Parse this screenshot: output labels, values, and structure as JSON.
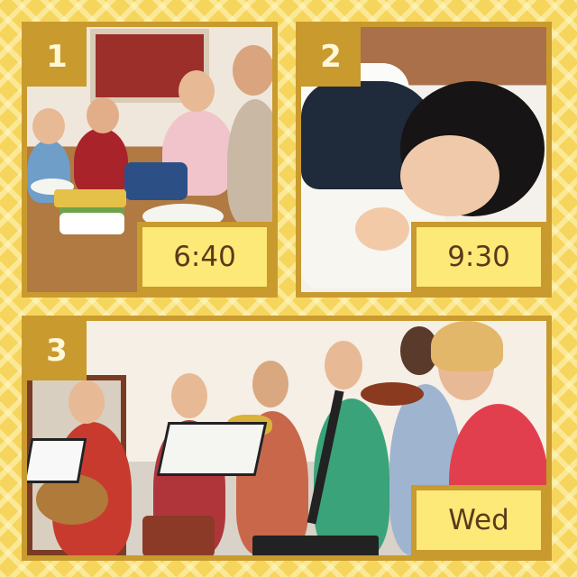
{
  "panels": [
    {
      "number": "1",
      "time": "6:40",
      "scene": "family-dinner"
    },
    {
      "number": "2",
      "time": "9:30",
      "scene": "child-sleeping"
    },
    {
      "number": "3",
      "time": "Wed",
      "scene": "school-band"
    }
  ],
  "colors": {
    "background": "#f6d55c",
    "frame": "#c99a2e",
    "label_fill": "#fde978",
    "label_text": "#5a3a1a",
    "number_text": "#fff7d6"
  }
}
